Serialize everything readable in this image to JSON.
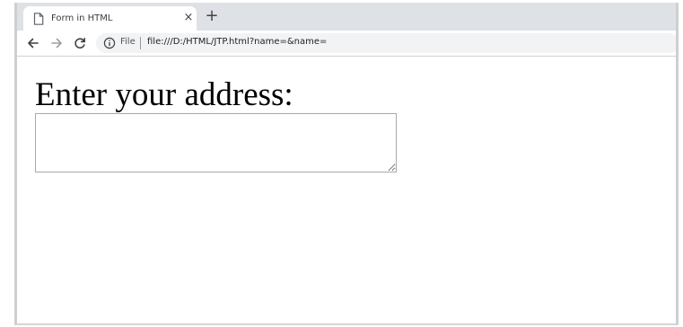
{
  "browser": {
    "tab": {
      "title": "Form in HTML",
      "close_glyph": "×",
      "icon": "page-icon"
    },
    "new_tab_glyph": "+",
    "toolbar": {
      "back_icon": "back-arrow-icon",
      "forward_icon": "forward-arrow-icon",
      "reload_icon": "reload-icon",
      "info_icon": "info-icon",
      "site_chip": "File",
      "url": "file:///D:/HTML/JTP.html?name=&name="
    }
  },
  "page": {
    "label": "Enter your address:",
    "textarea": {
      "value": "",
      "placeholder": ""
    }
  }
}
